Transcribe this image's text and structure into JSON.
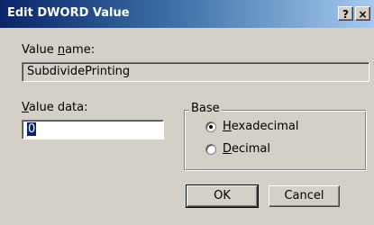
{
  "window": {
    "title": "Edit DWORD Value",
    "help_label": "?",
    "close_label": "×"
  },
  "value_name": {
    "label_accel": "n",
    "label_pre": "Value ",
    "label_post": "ame:",
    "value": "SubdividePrinting"
  },
  "value_data": {
    "label_accel": "V",
    "label_rest": "alue data:",
    "value": "0"
  },
  "base": {
    "title": "Base",
    "options": [
      {
        "accel": "H",
        "rest": "exadecimal",
        "selected": true
      },
      {
        "accel": "D",
        "rest": "ecimal",
        "selected": false
      }
    ]
  },
  "buttons": {
    "ok": "OK",
    "cancel": "Cancel"
  }
}
